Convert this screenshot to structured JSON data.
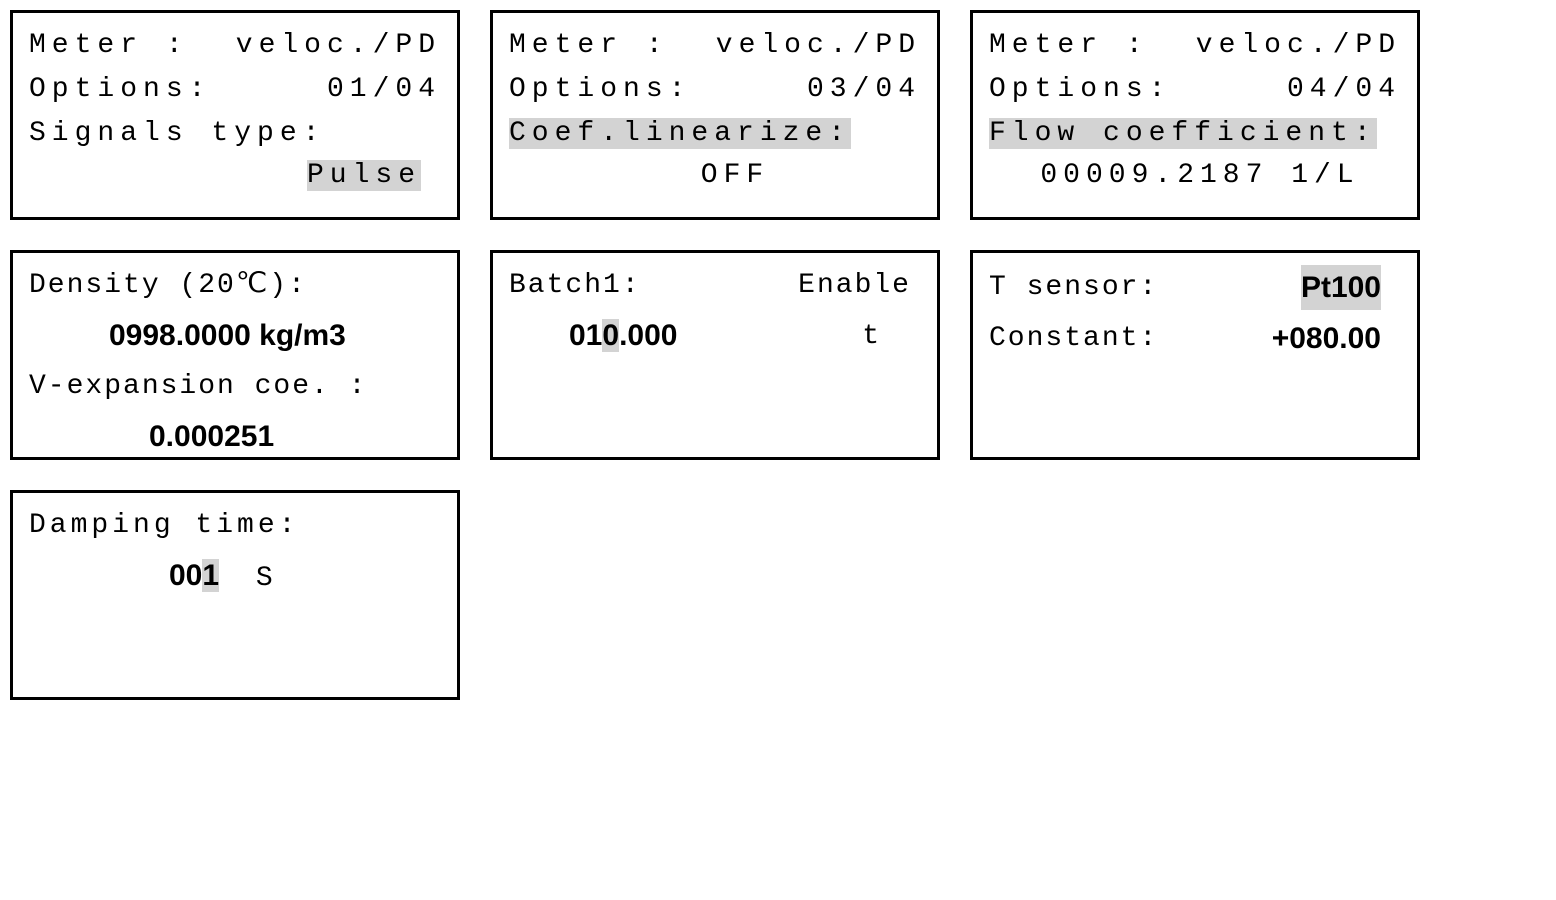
{
  "p1": {
    "meter_label": "Meter  :",
    "meter_value": "veloc./PD",
    "options_label": "Options:",
    "options_value": "01/04",
    "signals_label": "Signals type:",
    "signals_value": "Pulse"
  },
  "p2": {
    "meter_label": "Meter  :",
    "meter_value": "veloc./PD",
    "options_label": "Options:",
    "options_value": "03/04",
    "coef_label": "Coef.linearize:",
    "coef_value": "OFF"
  },
  "p3": {
    "meter_label": "Meter  :",
    "meter_value": "veloc./PD",
    "options_label": "Options:",
    "options_value": "04/04",
    "flow_label": "Flow coefficient:",
    "flow_value": "00009.2187  1/L"
  },
  "p4": {
    "density_label": "Density (20℃):",
    "density_value": "0998.0000 kg/m3",
    "vexp_label": "V-expansion coe. :",
    "vexp_value": "0.000251"
  },
  "p5": {
    "batch_label": "Batch1:",
    "batch_status": "Enable",
    "batch_pre": "01",
    "batch_cursor": "0",
    "batch_post": ".000",
    "batch_unit": "t"
  },
  "p6": {
    "tsensor_label": "T sensor:",
    "tsensor_value": "Pt100",
    "const_label": "Constant:",
    "const_value": "+080.00"
  },
  "p7": {
    "damp_label": "Damping  time:",
    "damp_pre": "00",
    "damp_cursor": "1",
    "damp_unit": "S"
  }
}
